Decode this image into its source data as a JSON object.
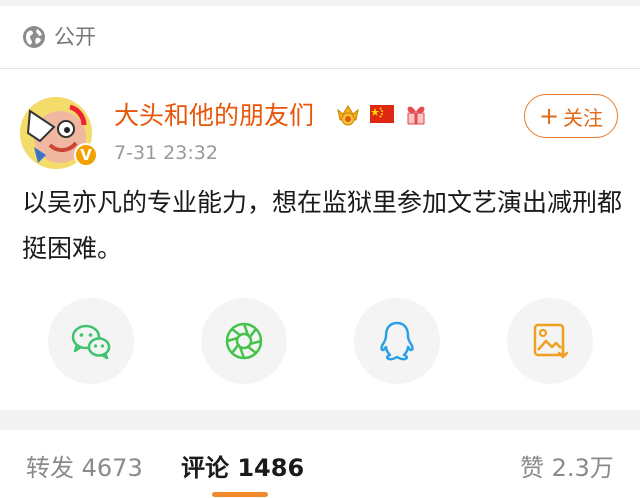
{
  "visibility": {
    "icon": "globe-icon",
    "label": "公开"
  },
  "post": {
    "author": "大头和他的朋友们",
    "verified_icon": "verified-v-badge-icon",
    "badges": [
      "crown-medal-icon",
      "china-flag-icon",
      "gift-bow-icon"
    ],
    "timestamp": "7-31 23:32",
    "follow_label": "关注",
    "text": "以吴亦凡的专业能力，想在监狱里参加文艺演出减刑都挺困难。"
  },
  "share": [
    {
      "name": "wechat-icon"
    },
    {
      "name": "moments-icon"
    },
    {
      "name": "qq-icon"
    },
    {
      "name": "save-image-icon"
    }
  ],
  "tabs": {
    "repost_label": "转发",
    "repost_count": "4673",
    "comments_label": "评论",
    "comments_count": "1486",
    "likes_label": "赞",
    "likes_count": "2.3万"
  },
  "colors": {
    "accent": "#e8560a",
    "follow": "#e26a17",
    "tab_indicator": "#f18a2a"
  }
}
